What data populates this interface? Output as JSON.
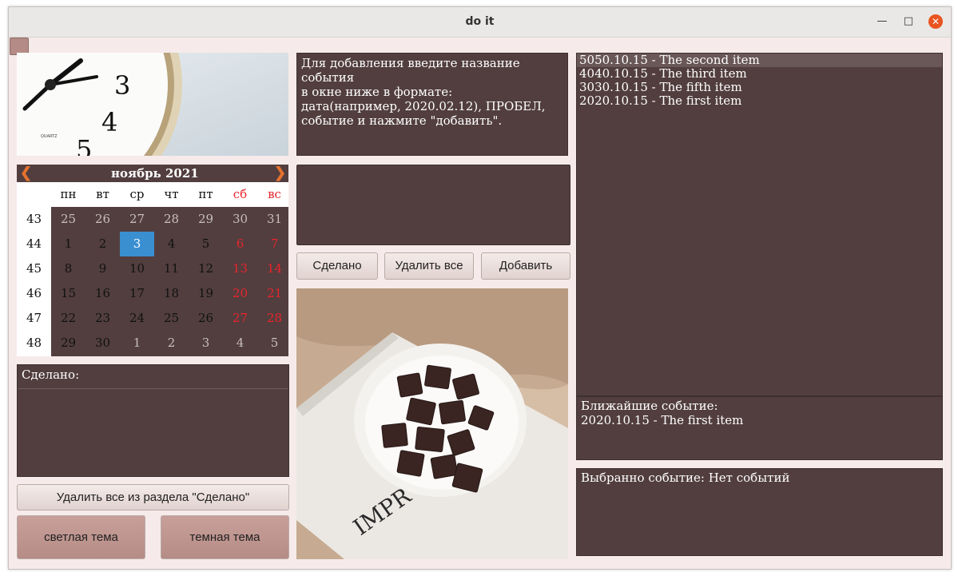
{
  "window": {
    "title": "do it"
  },
  "calendar": {
    "month": "ноябрь",
    "year": "2021",
    "weekdays": [
      "пн",
      "вт",
      "ср",
      "чт",
      "пт",
      "сб",
      "вс"
    ],
    "weeks": [
      {
        "num": "43",
        "days": [
          "25",
          "26",
          "27",
          "28",
          "29",
          "30",
          "31"
        ]
      },
      {
        "num": "44",
        "days": [
          "1",
          "2",
          "3",
          "4",
          "5",
          "6",
          "7"
        ]
      },
      {
        "num": "45",
        "days": [
          "8",
          "9",
          "10",
          "11",
          "12",
          "13",
          "14"
        ]
      },
      {
        "num": "46",
        "days": [
          "15",
          "16",
          "17",
          "18",
          "19",
          "20",
          "21"
        ]
      },
      {
        "num": "47",
        "days": [
          "22",
          "23",
          "24",
          "25",
          "26",
          "27",
          "28"
        ]
      },
      {
        "num": "48",
        "days": [
          "29",
          "30",
          "1",
          "2",
          "3",
          "4",
          "5"
        ]
      }
    ],
    "selected_day": "3",
    "colors": {
      "weekend": "#e8242c",
      "selected": "#3a8fd1",
      "other_month": "#c8bebe"
    }
  },
  "done_panel": {
    "label": "Сделано:"
  },
  "buttons": {
    "delete_done": "Удалить все из раздела \"Сделано\"",
    "light_theme": "светлая тема",
    "dark_theme": "темная тема",
    "done": "Сделано",
    "delete_all": "Удалить все",
    "add": "Добавить"
  },
  "instructions": {
    "lines": [
      "Для добавления введите название события",
      "в окне ниже в формате:",
      "дата(например, 2020.02.12), ПРОБЕЛ,",
      "событие и нажмите \"добавить\"."
    ]
  },
  "event_input": {
    "value": ""
  },
  "events": [
    "5050.10.15 - The second item",
    "4040.10.15 - The third item",
    "3030.10.15 - The fifth item",
    "2020.10.15 - The first item"
  ],
  "nearest": {
    "label": "Ближайшие событие:",
    "value": "2020.10.15 - The first item"
  },
  "selected_event": {
    "text": "Выбранно событие: Нет событий"
  },
  "images": {
    "clock_digits": [
      "3",
      "4",
      "5"
    ],
    "clock_brand": "QUARTZ",
    "book_text": "IMPR"
  },
  "theme": {
    "accent": "#523e3f",
    "background": "#f6ebea"
  }
}
